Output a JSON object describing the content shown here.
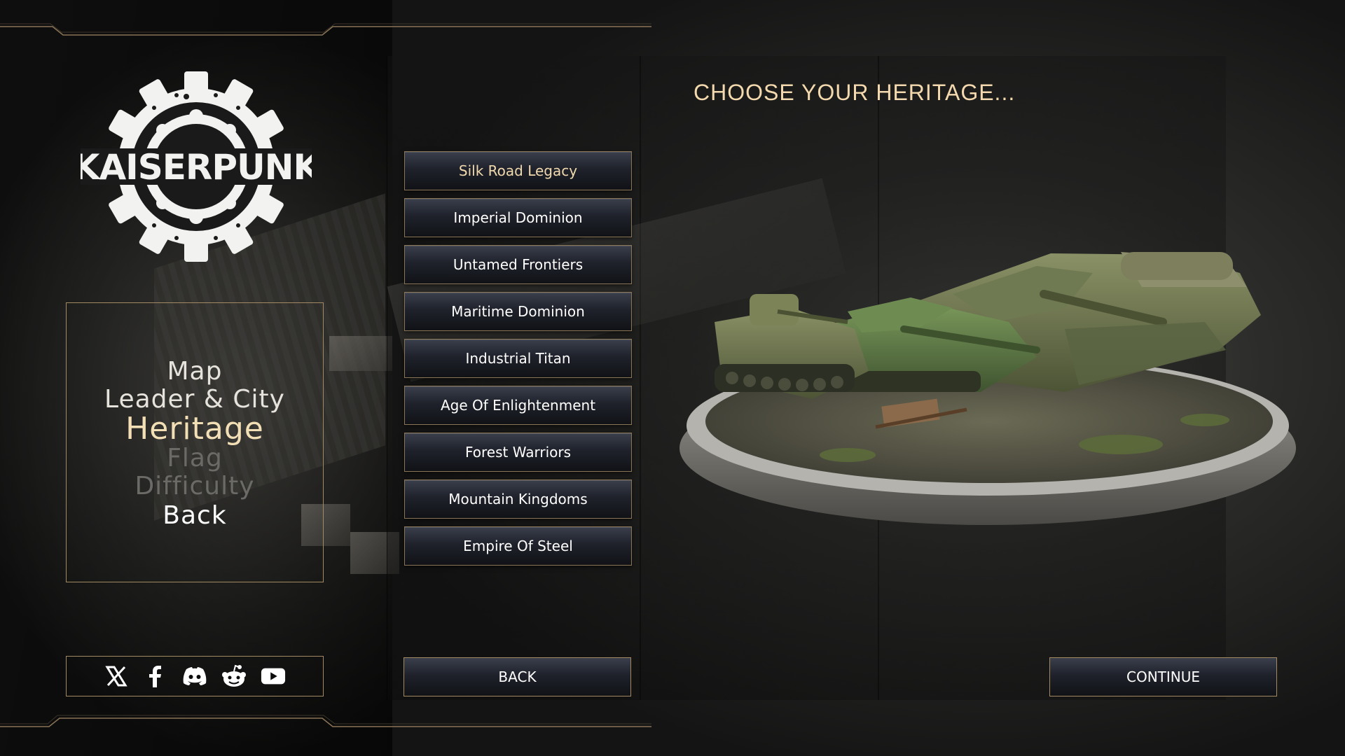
{
  "game": {
    "logo_text": "KAISERPUNK"
  },
  "menu": {
    "items": [
      {
        "label": "Map",
        "state": "done"
      },
      {
        "label": "Leader & City",
        "state": "done"
      },
      {
        "label": "Heritage",
        "state": "active"
      },
      {
        "label": "Flag",
        "state": "disabled"
      },
      {
        "label": "Difficulty",
        "state": "disabled"
      },
      {
        "label": "Back",
        "state": "enabled"
      }
    ]
  },
  "heritage": {
    "title": "CHOOSE YOUR HERITAGE...",
    "selected": "Silk Road Legacy",
    "options": [
      "Silk Road Legacy",
      "Imperial Dominion",
      "Untamed Frontiers",
      "Maritime Dominion",
      "Industrial Titan",
      "Age Of Enlightenment",
      "Forest Warriors",
      "Mountain Kingdoms",
      "Empire Of Steel"
    ]
  },
  "buttons": {
    "back": "BACK",
    "continue": "CONTINUE"
  },
  "social": [
    "x-icon",
    "facebook-icon",
    "discord-icon",
    "reddit-icon",
    "youtube-icon"
  ],
  "colors": {
    "accent_gold": "#a48a62",
    "title_text": "#f3d9ad",
    "active_menu": "#f3dfb6",
    "disabled_menu": "#6b6a66"
  }
}
